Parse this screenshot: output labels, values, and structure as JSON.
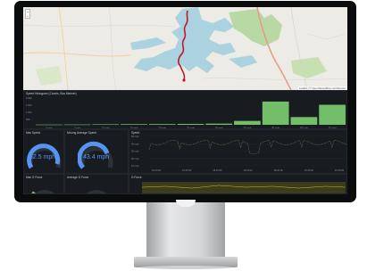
{
  "map": {
    "zoom_in": "+",
    "zoom_out": "−",
    "attribution": "Leaflet | © OpenStreetMap contributors"
  },
  "histogram": {
    "title": "Speed Histogram (Counts, Bus Mariner)",
    "y_ticks": [
      "2,000",
      "1,500",
      "1,000",
      "500",
      "0"
    ]
  },
  "panels": {
    "max_speed": {
      "title": "Max Speed",
      "value": "52.5 mph"
    },
    "moving_average": {
      "title": "Moving Average Speed",
      "value": "43.4 mph"
    },
    "speed_series": {
      "title": "Speed"
    },
    "max_g_force": {
      "title": "Max G Force"
    },
    "avg_g_force": {
      "title": "Average G Force"
    },
    "g_force_series": {
      "title": "G Force"
    }
  },
  "colors": {
    "panel_bg": "#181b1f",
    "bar_green": "#73bf69",
    "gauge_blue": "#5794f2",
    "route_red": "#c4162a"
  },
  "chart_data": [
    {
      "type": "bar",
      "title": "Speed Histogram (Counts, Bus Mariner)",
      "ylim": [
        0,
        2000
      ],
      "categories": [
        "0 mph",
        "5 mph",
        "10 mph",
        "15 mph",
        "20 mph",
        "25 mph",
        "30 mph",
        "35 mph",
        "40 mph",
        "45 mph",
        "50 mph"
      ],
      "values": [
        20,
        25,
        40,
        50,
        55,
        70,
        90,
        300,
        1800,
        600,
        1550
      ]
    },
    {
      "type": "line",
      "title": "Speed",
      "y_ticks": [
        "50 mph",
        "40 mph",
        "30 mph",
        "20 mph",
        "10 mph"
      ],
      "x_ticks": [
        "15:00:00",
        "15:05:00",
        "15:10:00",
        "15:15:00",
        "15:20:00",
        "15:25:00",
        "15:30:00"
      ]
    }
  ]
}
